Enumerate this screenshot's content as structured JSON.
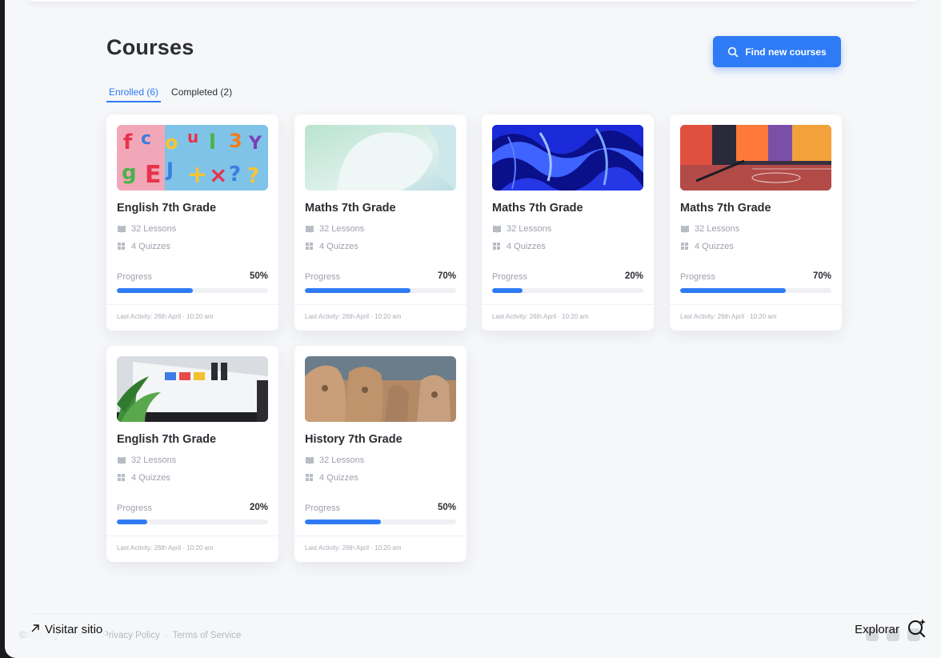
{
  "header": {
    "title": "Courses",
    "find_button_label": "Find new courses"
  },
  "tabs": [
    {
      "label": "Enrolled (6)",
      "active": true
    },
    {
      "label": "Completed (2)",
      "active": false
    }
  ],
  "courses": [
    {
      "title": "English 7th Grade",
      "lessons": "32 Lessons",
      "quizzes": "4 Quizzes",
      "progress_label": "Progress",
      "progress": "50%",
      "progress_fraction": 0.5,
      "last_activity": "Last Activity: 26th April · 10:20 am",
      "image": "colorful-letters"
    },
    {
      "title": "Maths 7th Grade",
      "lessons": "32 Lessons",
      "quizzes": "4 Quizzes",
      "progress_label": "Progress",
      "progress": "70%",
      "progress_fraction": 0.7,
      "last_activity": "Last Activity: 26th April · 10:20 am",
      "image": "soft-abstract"
    },
    {
      "title": "Maths 7th Grade",
      "lessons": "32 Lessons",
      "quizzes": "4 Quizzes",
      "progress_label": "Progress",
      "progress": "20%",
      "progress_fraction": 0.2,
      "last_activity": "Last Activity: 26th April · 10:20 am",
      "image": "blue-waves"
    },
    {
      "title": "Maths 7th Grade",
      "lessons": "32 Lessons",
      "quizzes": "4 Quizzes",
      "progress_label": "Progress",
      "progress": "70%",
      "progress_fraction": 0.7,
      "last_activity": "Last Activity: 26th April · 10:20 am",
      "image": "colorful-court"
    },
    {
      "title": "English 7th Grade",
      "lessons": "32 Lessons",
      "quizzes": "4 Quizzes",
      "progress_label": "Progress",
      "progress": "20%",
      "progress_fraction": 0.2,
      "last_activity": "Last Activity: 26th April · 10:20 am",
      "image": "desk-monitor-plant"
    },
    {
      "title": "History 7th Grade",
      "lessons": "32 Lessons",
      "quizzes": "4 Quizzes",
      "progress_label": "Progress",
      "progress": "50%",
      "progress_fraction": 0.5,
      "last_activity": "Last Activity: 26th April · 10:20 am",
      "image": "mount-rushmore"
    }
  ],
  "footer": {
    "copyright": "©Schooly 2023",
    "privacy": "Privacy Policy",
    "separator": "·",
    "terms": "Terms of Service"
  },
  "overlay": {
    "visit_label": "Visitar sitio",
    "explore_label": "Explorar"
  },
  "colors": {
    "accent": "#2f7bf5"
  }
}
